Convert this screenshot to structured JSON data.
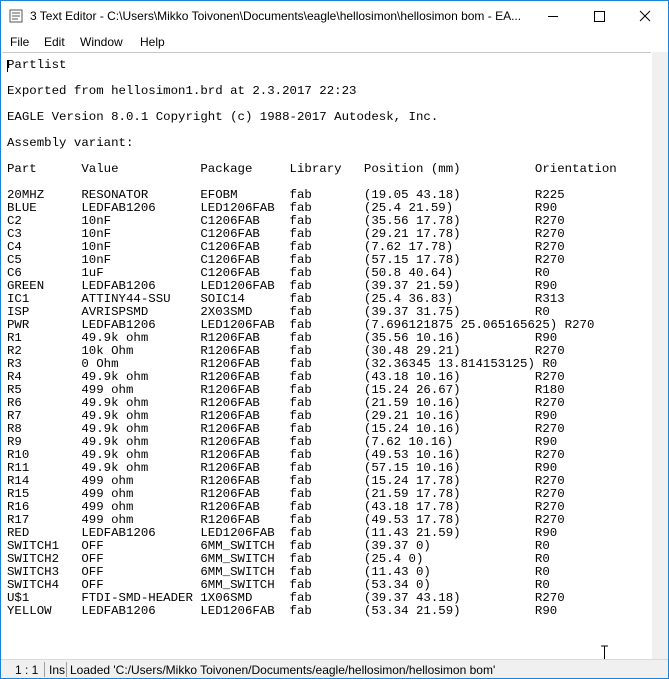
{
  "window": {
    "title": "3 Text Editor - C:\\Users\\Mikko Toivonen\\Documents\\eagle\\hellosimon\\hellosimon bom - EA..."
  },
  "menu": [
    "File",
    "Edit",
    "Window",
    "Help"
  ],
  "document": {
    "lines": [
      "Partlist",
      "",
      "Exported from hellosimon1.brd at 2.3.2017 22:23",
      "",
      "EAGLE Version 8.0.1 Copyright (c) 1988-2017 Autodesk, Inc.",
      "",
      "Assembly variant:",
      "",
      "Part      Value           Package     Library   Position (mm)          Orientation",
      "",
      "20MHZ     RESONATOR       EFOBM       fab       (19.05 43.18)          R225",
      "BLUE      LEDFAB1206      LED1206FAB  fab       (25.4 21.59)           R90",
      "C2        10nF            C1206FAB    fab       (35.56 17.78)          R270",
      "C3        10nF            C1206FAB    fab       (29.21 17.78)          R270",
      "C4        10nF            C1206FAB    fab       (7.62 17.78)           R270",
      "C5        10nF            C1206FAB    fab       (57.15 17.78)          R270",
      "C6        1uF             C1206FAB    fab       (50.8 40.64)           R0",
      "GREEN     LEDFAB1206      LED1206FAB  fab       (39.37 21.59)          R90",
      "IC1       ATTINY44-SSU    SOIC14      fab       (25.4 36.83)           R313",
      "ISP       AVRISPSMD       2X03SMD     fab       (39.37 31.75)          R0",
      "PWR       LEDFAB1206      LED1206FAB  fab       (7.696121875 25.065165625) R270",
      "R1        49.9k ohm       R1206FAB    fab       (35.56 10.16)          R90",
      "R2        10k Ohm         R1206FAB    fab       (30.48 29.21)          R270",
      "R3        0 Ohm           R1206FAB    fab       (32.36345 13.814153125) R0",
      "R4        49.9k ohm       R1206FAB    fab       (43.18 10.16)          R270",
      "R5        499 ohm         R1206FAB    fab       (15.24 26.67)          R180",
      "R6        49.9k ohm       R1206FAB    fab       (21.59 10.16)          R270",
      "R7        49.9k ohm       R1206FAB    fab       (29.21 10.16)          R90",
      "R8        49.9k ohm       R1206FAB    fab       (15.24 10.16)          R270",
      "R9        49.9k ohm       R1206FAB    fab       (7.62 10.16)           R90",
      "R10       49.9k ohm       R1206FAB    fab       (49.53 10.16)          R270",
      "R11       49.9k ohm       R1206FAB    fab       (57.15 10.16)          R90",
      "R14       499 ohm         R1206FAB    fab       (15.24 17.78)          R270",
      "R15       499 ohm         R1206FAB    fab       (21.59 17.78)          R270",
      "R16       499 ohm         R1206FAB    fab       (43.18 17.78)          R270",
      "R17       499 ohm         R1206FAB    fab       (49.53 17.78)          R270",
      "RED       LEDFAB1206      LED1206FAB  fab       (11.43 21.59)          R90",
      "SWITCH1   OFF             6MM_SWITCH  fab       (39.37 0)              R0",
      "SWITCH2   OFF             6MM_SWITCH  fab       (25.4 0)               R0",
      "SWITCH3   OFF             6MM_SWITCH  fab       (11.43 0)              R0",
      "SWITCH4   OFF             6MM_SWITCH  fab       (53.34 0)              R0",
      "U$1       FTDI-SMD-HEADER 1X06SMD     fab       (39.37 43.18)          R270",
      "YELLOW    LEDFAB1206      LED1206FAB  fab       (53.34 21.59)          R90"
    ]
  },
  "status": {
    "position": "1 : 1",
    "mode": "Ins",
    "message": "Loaded 'C:/Users/Mikko Toivonen/Documents/eagle/hellosimon/hellosimon bom'"
  },
  "icons": {
    "app": "text-editor-icon",
    "minimize": "minimize-icon",
    "maximize": "maximize-icon",
    "close": "close-icon",
    "cursor": "ibeam-cursor-icon"
  }
}
